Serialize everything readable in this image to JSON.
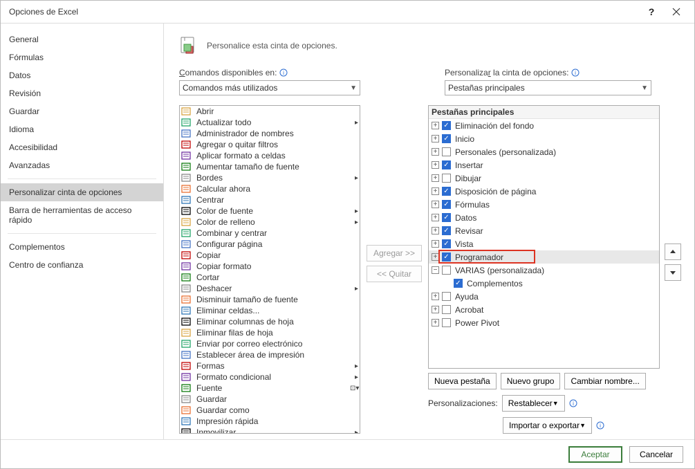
{
  "title": "Opciones de Excel",
  "sidebar": {
    "items": [
      {
        "label": "General"
      },
      {
        "label": "Fórmulas"
      },
      {
        "label": "Datos"
      },
      {
        "label": "Revisión"
      },
      {
        "label": "Guardar"
      },
      {
        "label": "Idioma"
      },
      {
        "label": "Accesibilidad"
      },
      {
        "label": "Avanzadas"
      }
    ],
    "items2": [
      {
        "label": "Personalizar cinta de opciones",
        "selected": true
      },
      {
        "label": "Barra de herramientas de acceso rápido"
      }
    ],
    "items3": [
      {
        "label": "Complementos"
      },
      {
        "label": "Centro de confianza"
      }
    ]
  },
  "header": "Personalice esta cinta de opciones.",
  "left": {
    "label": "Comandos disponibles en:",
    "combo": "Comandos más utilizados",
    "commands": [
      {
        "label": "Abrir",
        "sub": ""
      },
      {
        "label": "Actualizar todo",
        "sub": "▸"
      },
      {
        "label": "Administrador de nombres",
        "sub": ""
      },
      {
        "label": "Agregar o quitar filtros",
        "sub": ""
      },
      {
        "label": "Aplicar formato a celdas",
        "sub": ""
      },
      {
        "label": "Aumentar tamaño de fuente",
        "sub": ""
      },
      {
        "label": "Bordes",
        "sub": "▸"
      },
      {
        "label": "Calcular ahora",
        "sub": ""
      },
      {
        "label": "Centrar",
        "sub": ""
      },
      {
        "label": "Color de fuente",
        "sub": "▸"
      },
      {
        "label": "Color de relleno",
        "sub": "▸"
      },
      {
        "label": "Combinar y centrar",
        "sub": ""
      },
      {
        "label": "Configurar página",
        "sub": ""
      },
      {
        "label": "Copiar",
        "sub": ""
      },
      {
        "label": "Copiar formato",
        "sub": ""
      },
      {
        "label": "Cortar",
        "sub": ""
      },
      {
        "label": "Deshacer",
        "sub": "▸"
      },
      {
        "label": "Disminuir tamaño de fuente",
        "sub": ""
      },
      {
        "label": "Eliminar celdas...",
        "sub": ""
      },
      {
        "label": "Eliminar columnas de hoja",
        "sub": ""
      },
      {
        "label": "Eliminar filas de hoja",
        "sub": ""
      },
      {
        "label": "Enviar por correo electrónico",
        "sub": ""
      },
      {
        "label": "Establecer área de impresión",
        "sub": ""
      },
      {
        "label": "Formas",
        "sub": "▸"
      },
      {
        "label": "Formato condicional",
        "sub": "▸"
      },
      {
        "label": "Fuente",
        "sub": "⊡▾"
      },
      {
        "label": "Guardar",
        "sub": ""
      },
      {
        "label": "Guardar como",
        "sub": ""
      },
      {
        "label": "Impresión rápida",
        "sub": ""
      },
      {
        "label": "Inmovilizar",
        "sub": "▸"
      }
    ]
  },
  "mid": {
    "add": "Agregar >>",
    "remove": "<< Quitar"
  },
  "right": {
    "label": "Personalizar la cinta de opciones:",
    "combo": "Pestañas principales",
    "tree_header": "Pestañas principales",
    "items": [
      {
        "label": "Eliminación del fondo",
        "checked": true,
        "expander": "+"
      },
      {
        "label": "Inicio",
        "checked": true,
        "expander": "+"
      },
      {
        "label": "Personales (personalizada)",
        "checked": false,
        "expander": "+"
      },
      {
        "label": "Insertar",
        "checked": true,
        "expander": "+"
      },
      {
        "label": "Dibujar",
        "checked": false,
        "expander": "+"
      },
      {
        "label": "Disposición de página",
        "checked": true,
        "expander": "+"
      },
      {
        "label": "Fórmulas",
        "checked": true,
        "expander": "+"
      },
      {
        "label": "Datos",
        "checked": true,
        "expander": "+"
      },
      {
        "label": "Revisar",
        "checked": true,
        "expander": "+"
      },
      {
        "label": "Vista",
        "checked": true,
        "expander": "+"
      },
      {
        "label": "Programador",
        "checked": true,
        "expander": "+",
        "highlight": true,
        "redbox": true
      },
      {
        "label": "VARIAS (personalizada)",
        "checked": false,
        "expander": "−",
        "children": [
          {
            "label": "Complementos",
            "checked": true
          }
        ]
      },
      {
        "label": "Ayuda",
        "checked": false,
        "expander": "+"
      },
      {
        "label": "Acrobat",
        "checked": false,
        "expander": "+"
      },
      {
        "label": "Power Pivot",
        "checked": false,
        "expander": "+"
      }
    ],
    "buttons": {
      "new_tab": "Nueva pestaña",
      "new_group": "Nuevo grupo",
      "rename": "Cambiar nombre..."
    },
    "customizations": "Personalizaciones:",
    "reset": "Restablecer",
    "import_export": "Importar o exportar"
  },
  "footer": {
    "ok": "Aceptar",
    "cancel": "Cancelar"
  },
  "icon_colors": [
    "#d9a441",
    "#21a366",
    "#4472c4",
    "#c00000",
    "#7030a0",
    "#0f7b0f",
    "#888",
    "#e97132",
    "#2e75b6",
    "#000"
  ]
}
